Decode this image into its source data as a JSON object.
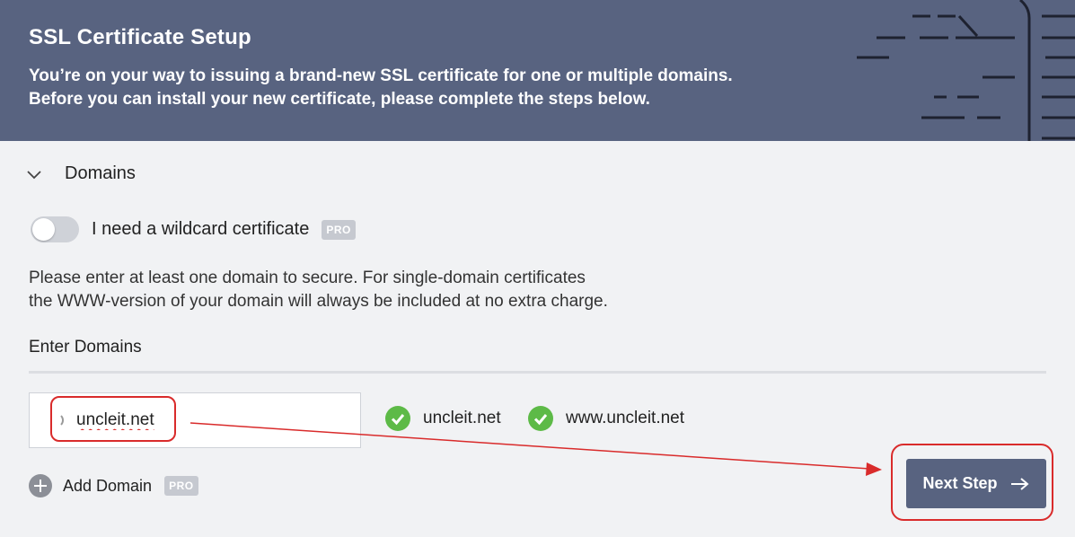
{
  "header": {
    "title": "SSL Certificate Setup",
    "desc_line1": "You’re on your way to issuing a brand-new SSL certificate for one or multiple domains.",
    "desc_line2": "Before you can install your new certificate, please complete the steps below."
  },
  "domains_section": {
    "label": "Domains",
    "wildcard_label": "I need a wildcard certificate",
    "wildcard_enabled": false,
    "pro_badge": "PRO",
    "info_line1": "Please enter at least one domain to secure. For single-domain certificates",
    "info_line2": "the WWW-version of your domain will always be included at no extra charge.",
    "enter_label": "Enter Domains",
    "domain_value": "uncleit.net",
    "validated": [
      "uncleit.net",
      "www.uncleit.net"
    ],
    "add_domain_label": "Add Domain",
    "add_pro_badge": "PRO"
  },
  "actions": {
    "next_label": "Next Step"
  },
  "icons": {
    "section_toggle": "chevron-down-icon",
    "spinner": "loading-spinner-icon",
    "check": "check-circle-icon",
    "add": "plus-circle-icon",
    "next": "arrow-right-icon"
  },
  "colors": {
    "header_bg": "#586380",
    "check_green": "#5dba47",
    "button_bg": "#586380",
    "annotation_red": "#d92b2b"
  }
}
